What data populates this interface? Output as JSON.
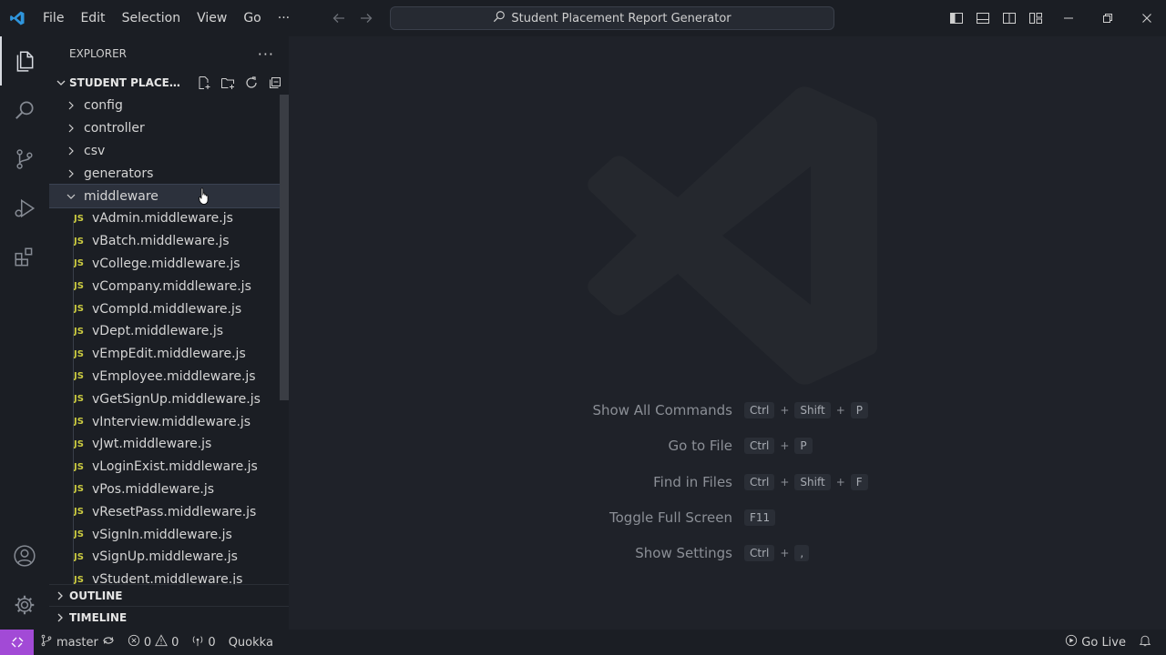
{
  "titlebar": {
    "menu": [
      "File",
      "Edit",
      "Selection",
      "View",
      "Go",
      "···"
    ],
    "command_center": "Student Placement Report Generator"
  },
  "sidebar": {
    "header": "EXPLORER",
    "project": "STUDENT PLACEMENT REPORT GENERATOR",
    "folders_top": [
      "config",
      "controller",
      "csv",
      "generators"
    ],
    "expanded_folder": "middleware",
    "files": [
      "vAdmin.middleware.js",
      "vBatch.middleware.js",
      "vCollege.middleware.js",
      "vCompany.middleware.js",
      "vCompId.middleware.js",
      "vDept.middleware.js",
      "vEmpEdit.middleware.js",
      "vEmployee.middleware.js",
      "vGetSignUp.middleware.js",
      "vInterview.middleware.js",
      "vJwt.middleware.js",
      "vLoginExist.middleware.js",
      "vPos.middleware.js",
      "vResetPass.middleware.js",
      "vSignIn.middleware.js",
      "vSignUp.middleware.js",
      "vStudent.middleware.js"
    ],
    "file_badge": "JS",
    "outline": "OUTLINE",
    "timeline": "TIMELINE"
  },
  "editor": {
    "shortcuts": [
      {
        "label": "Show All Commands",
        "keys": [
          "Ctrl",
          "Shift",
          "P"
        ]
      },
      {
        "label": "Go to File",
        "keys": [
          "Ctrl",
          "P"
        ]
      },
      {
        "label": "Find in Files",
        "keys": [
          "Ctrl",
          "Shift",
          "F"
        ]
      },
      {
        "label": "Toggle Full Screen",
        "keys": [
          "F11"
        ]
      },
      {
        "label": "Show Settings",
        "keys": [
          "Ctrl",
          ","
        ]
      }
    ]
  },
  "statusbar": {
    "branch": "master",
    "errors": "0",
    "warnings": "0",
    "ports": "0",
    "quokka": "Quokka",
    "go_live": "Go Live"
  },
  "colors": {
    "remote_indicator": "#a24ad6",
    "js_badge": "#cbcb41",
    "vscode_logo": "#2f95dc"
  }
}
